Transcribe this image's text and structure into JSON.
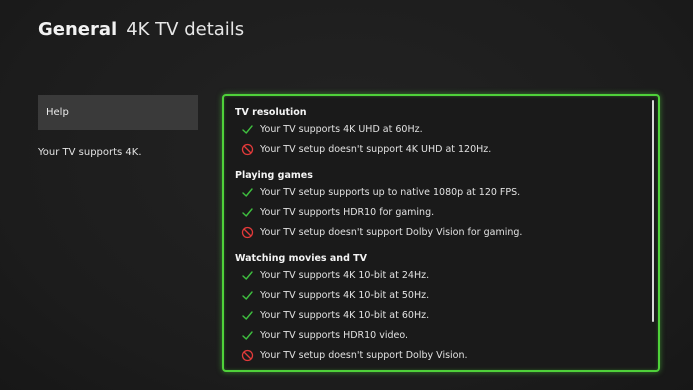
{
  "header": {
    "section": "General",
    "title": "4K TV details"
  },
  "sidebar": {
    "help_label": "Help",
    "description": "Your TV supports 4K."
  },
  "panel": {
    "sections": [
      {
        "heading": "TV resolution",
        "items": [
          {
            "status": "supported",
            "icon": "check-icon",
            "text": "Your TV supports 4K UHD at 60Hz."
          },
          {
            "status": "unsupported",
            "icon": "prohibited-icon",
            "text": "Your TV setup doesn't support 4K UHD at 120Hz."
          }
        ]
      },
      {
        "heading": "Playing games",
        "items": [
          {
            "status": "supported",
            "icon": "check-icon",
            "text": "Your TV setup supports up to native 1080p at 120 FPS."
          },
          {
            "status": "supported",
            "icon": "check-icon",
            "text": "Your TV supports HDR10 for gaming."
          },
          {
            "status": "unsupported",
            "icon": "prohibited-icon",
            "text": "Your TV setup doesn't support Dolby Vision for gaming."
          }
        ]
      },
      {
        "heading": "Watching movies and TV",
        "items": [
          {
            "status": "supported",
            "icon": "check-icon",
            "text": "Your TV supports 4K 10-bit at 24Hz."
          },
          {
            "status": "supported",
            "icon": "check-icon",
            "text": "Your TV supports 4K 10-bit at 50Hz."
          },
          {
            "status": "supported",
            "icon": "check-icon",
            "text": "Your TV supports 4K 10-bit at 60Hz."
          },
          {
            "status": "supported",
            "icon": "check-icon",
            "text": "Your TV supports HDR10 video."
          },
          {
            "status": "unsupported",
            "icon": "prohibited-icon",
            "text": "Your TV setup doesn't support Dolby Vision."
          }
        ]
      }
    ]
  },
  "colors": {
    "focus_border": "#4fd13a",
    "check": "#3fbf3f",
    "prohibited": "#e23a3a"
  }
}
